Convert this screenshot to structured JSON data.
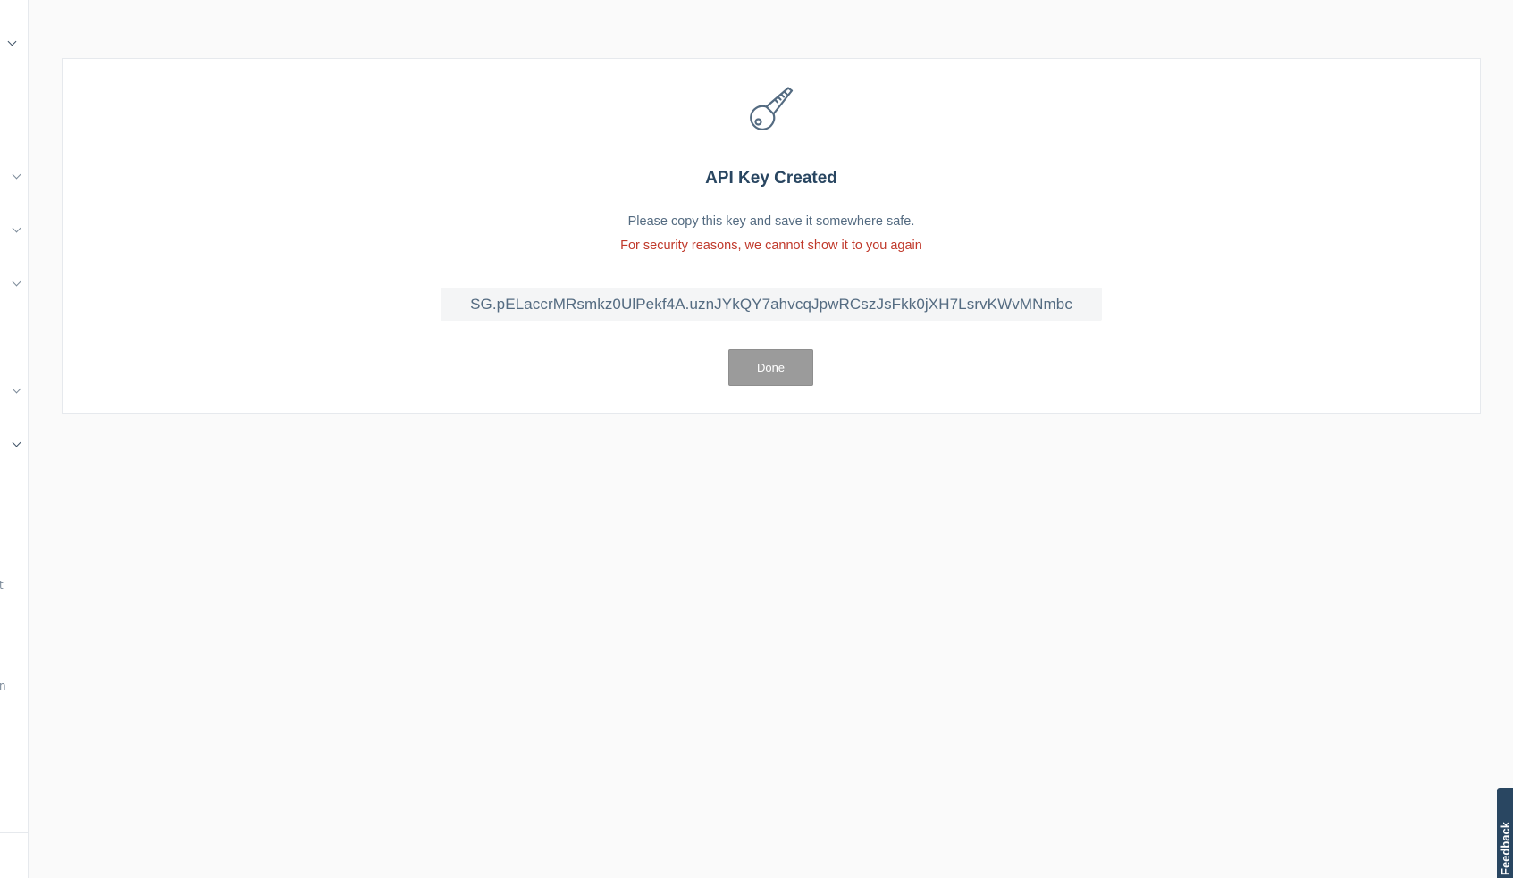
{
  "sidebar": {
    "fragments": [
      "t",
      "n"
    ]
  },
  "dialog": {
    "icon": "key-icon",
    "title": "API Key Created",
    "message": "Please copy this key and save it somewhere safe.",
    "warning": "For security reasons, we cannot show it to you again",
    "api_key": "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",
    "done_label": "Done"
  },
  "feedback": {
    "label": "Feedback"
  },
  "colors": {
    "title": "#294661",
    "warning": "#c0392b",
    "button": "#9b9b9b",
    "feedback": "#294661"
  }
}
